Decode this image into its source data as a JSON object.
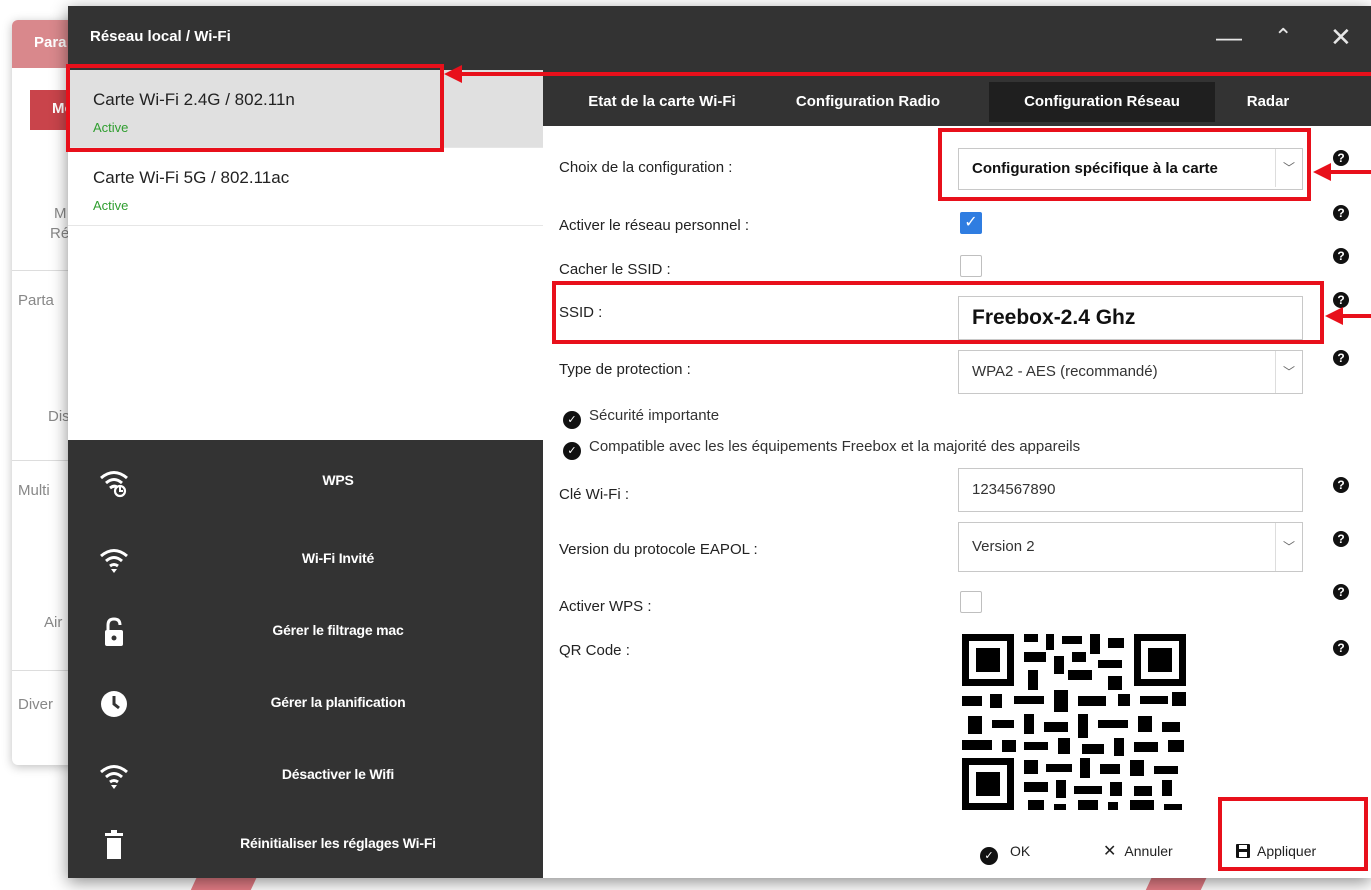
{
  "background_window": {
    "title_fragment": "Para",
    "tab_fragment": "Mo",
    "texts": [
      "M",
      "Ré",
      "Parta",
      "Dis",
      "Multi",
      "Air",
      "Diver"
    ]
  },
  "window": {
    "title": "Réseau local / Wi-Fi",
    "controls": {
      "minimize": "—",
      "maximize": "⌃",
      "close": "✕"
    }
  },
  "cards": [
    {
      "name": "Carte Wi-Fi 2.4G / 802.11n",
      "status": "Active",
      "selected": true
    },
    {
      "name": "Carte Wi-Fi 5G / 802.11ac",
      "status": "Active",
      "selected": false
    }
  ],
  "actions": [
    {
      "label": "WPS",
      "icon": "wifi-wps-icon"
    },
    {
      "label": "Wi-Fi Invité",
      "icon": "wifi-icon"
    },
    {
      "label": "Gérer le filtrage mac",
      "icon": "lock-open-icon"
    },
    {
      "label": "Gérer la planification",
      "icon": "clock-icon"
    },
    {
      "label": "Désactiver le Wifi",
      "icon": "wifi-icon"
    },
    {
      "label": "Réinitialiser les réglages Wi-Fi",
      "icon": "trash-icon"
    }
  ],
  "tabs": [
    {
      "label": "Etat de la carte Wi-Fi",
      "active": false
    },
    {
      "label": "Configuration Radio",
      "active": false
    },
    {
      "label": "Configuration Réseau",
      "active": true
    },
    {
      "label": "Radar",
      "active": false
    }
  ],
  "form": {
    "config_label": "Choix de la configuration :",
    "config_value": "Configuration spécifique à la carte",
    "personal_label": "Activer le réseau personnel :",
    "personal_checked": true,
    "hide_ssid_label": "Cacher le SSID :",
    "hide_ssid_checked": false,
    "ssid_label": "SSID :",
    "ssid_value": "Freebox-2.4 Ghz",
    "protection_label": "Type de protection :",
    "protection_value": "WPA2 - AES (recommandé)",
    "note_security": "Sécurité importante",
    "note_compat": "Compatible avec les les équipements Freebox et la majorité des appareils",
    "key_label": "Clé Wi-Fi :",
    "key_value": "1234567890",
    "eapol_label": "Version du protocole EAPOL :",
    "eapol_value": "Version 2",
    "wps_label": "Activer WPS :",
    "wps_checked": false,
    "qr_label": "QR Code :"
  },
  "footer": {
    "ok": "OK",
    "cancel": "Annuler",
    "apply": "Appliquer"
  },
  "colors": {
    "annotation_red": "#e8101b",
    "active_green": "#2f9e2f",
    "window_dark": "#333333",
    "checkbox_blue": "#2f7de1"
  }
}
